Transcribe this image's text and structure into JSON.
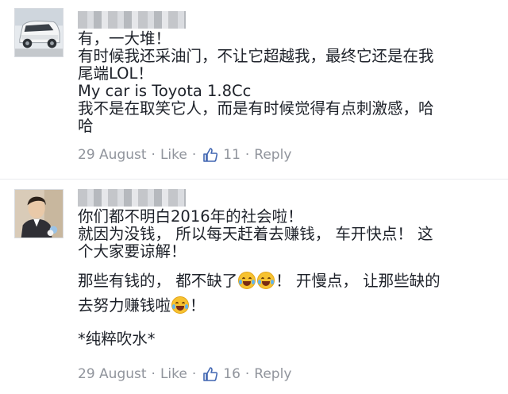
{
  "comments": [
    {
      "lines": [
        "有，一大堆！",
        "有时候我还采油门，不让它超越我，最终它还是在我",
        "尾端LOL！",
        "My car is Toyota 1.8Cc",
        "我不是在取笑它人，而是有时候觉得有点刺激感，哈",
        "哈"
      ],
      "date": "29 August",
      "like_label": "Like",
      "like_count": "11",
      "reply_label": "Reply",
      "separator": "·"
    },
    {
      "lines": [
        "你们都不明白2016年的社会啦！",
        "就因为没钱， 所以每天赶着去赚钱， 车开快点！ 这",
        "个大家要谅解！",
        "那些有钱的， 都不缺了",
        "！ 开慢点， 让那些缺的",
        "去努力赚钱啦",
        "！",
        "*纯粹吹水*"
      ],
      "date": "29 August",
      "like_label": "Like",
      "like_count": "16",
      "reply_label": "Reply",
      "separator": "·"
    }
  ],
  "icons": {
    "like": "thumbs-up-icon",
    "emoji": "tears-of-joy-emoji"
  },
  "colors": {
    "text": "#1d2129",
    "meta": "#90949c",
    "like_blue": "#4267b2"
  }
}
